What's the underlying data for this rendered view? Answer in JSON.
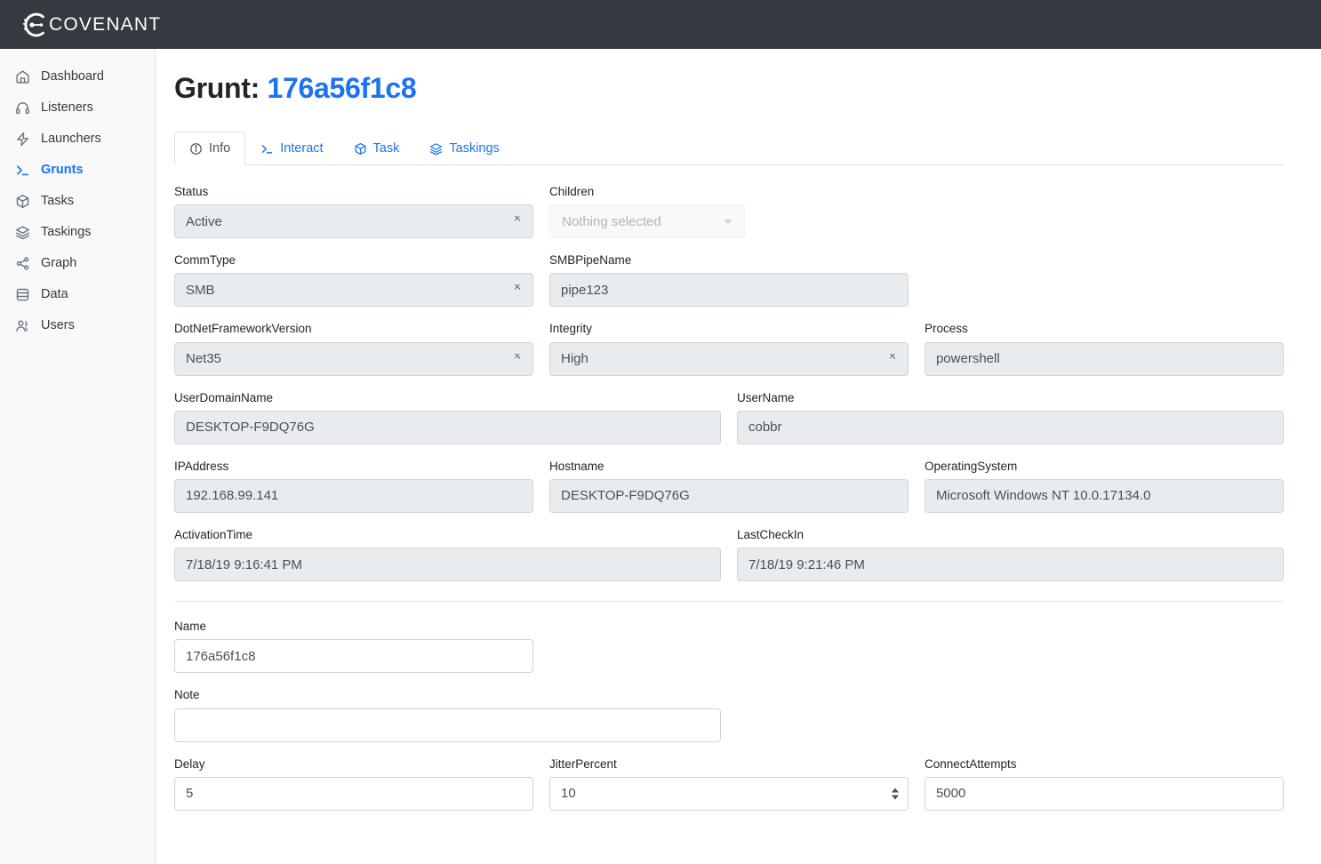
{
  "brand": {
    "name": "COVENANT",
    "logo_icon": "covenant-ring-icon",
    "bar_color": "#343a40"
  },
  "sidebar": {
    "items": [
      {
        "label": "Dashboard",
        "icon": "home-icon",
        "active": false
      },
      {
        "label": "Listeners",
        "icon": "headphones-icon",
        "active": false
      },
      {
        "label": "Launchers",
        "icon": "bolt-icon",
        "active": false
      },
      {
        "label": "Grunts",
        "icon": "terminal-icon",
        "active": true
      },
      {
        "label": "Tasks",
        "icon": "cube-icon",
        "active": false
      },
      {
        "label": "Taskings",
        "icon": "layers-icon",
        "active": false
      },
      {
        "label": "Graph",
        "icon": "share-icon",
        "active": false
      },
      {
        "label": "Data",
        "icon": "database-icon",
        "active": false
      },
      {
        "label": "Users",
        "icon": "users-icon",
        "active": false
      }
    ]
  },
  "page": {
    "title_prefix": "Grunt:",
    "title_name": "176a56f1c8",
    "accent_color": "#1a73f0"
  },
  "tabs": [
    {
      "label": "Info",
      "icon": "info-circle-icon",
      "active": true
    },
    {
      "label": "Interact",
      "icon": "terminal-icon",
      "active": false
    },
    {
      "label": "Task",
      "icon": "cube-icon",
      "active": false
    },
    {
      "label": "Taskings",
      "icon": "layers-icon",
      "active": false
    }
  ],
  "form": {
    "status": {
      "label": "Status",
      "value": "Active"
    },
    "children": {
      "label": "Children",
      "placeholder": "Nothing selected"
    },
    "commtype": {
      "label": "CommType",
      "value": "SMB"
    },
    "smbpipename": {
      "label": "SMBPipeName",
      "value": "pipe123"
    },
    "dotnet": {
      "label": "DotNetFrameworkVersion",
      "value": "Net35"
    },
    "integrity": {
      "label": "Integrity",
      "value": "High"
    },
    "process": {
      "label": "Process",
      "value": "powershell"
    },
    "userdomain": {
      "label": "UserDomainName",
      "value": "DESKTOP-F9DQ76G"
    },
    "username": {
      "label": "UserName",
      "value": "cobbr"
    },
    "ipaddress": {
      "label": "IPAddress",
      "value": "192.168.99.141"
    },
    "hostname": {
      "label": "Hostname",
      "value": "DESKTOP-F9DQ76G"
    },
    "os": {
      "label": "OperatingSystem",
      "value": "Microsoft Windows NT 10.0.17134.0"
    },
    "activationtime": {
      "label": "ActivationTime",
      "value": "7/18/19 9:16:41 PM"
    },
    "lastcheckin": {
      "label": "LastCheckIn",
      "value": "7/18/19 9:21:46 PM"
    },
    "name": {
      "label": "Name",
      "value": "176a56f1c8"
    },
    "note": {
      "label": "Note",
      "value": ""
    },
    "delay": {
      "label": "Delay",
      "value": "5"
    },
    "jitterpercent": {
      "label": "JitterPercent",
      "value": "10"
    },
    "connectattempts": {
      "label": "ConnectAttempts",
      "value": "5000"
    }
  }
}
